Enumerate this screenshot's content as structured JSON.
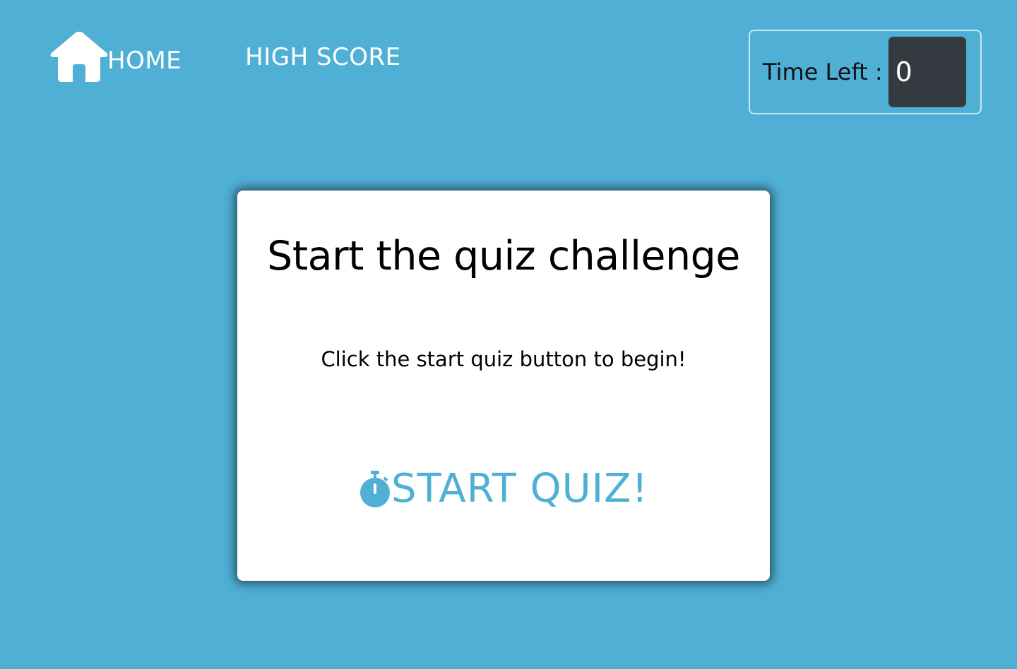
{
  "nav": {
    "home_label": "HOME",
    "highscore_label": "HIGH SCORE",
    "home_icon": "home-icon"
  },
  "timer": {
    "label": "Time Left :",
    "value": "0"
  },
  "card": {
    "title": "Start the quiz challenge",
    "text": "Click the start quiz button to begin!",
    "start_label": "START QUIZ!",
    "start_icon": "stopwatch-icon"
  },
  "colors": {
    "background": "#4fafd5",
    "accent": "#4fafd5",
    "timer_bg": "#343a40",
    "card_bg": "#ffffff"
  }
}
